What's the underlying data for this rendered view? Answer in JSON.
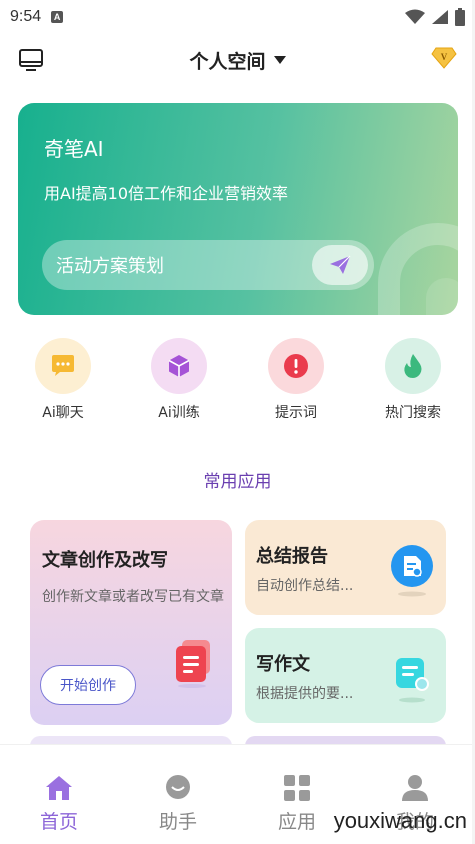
{
  "status_bar": {
    "time": "9:54",
    "notif_letter": "A"
  },
  "header": {
    "title": "个人空间"
  },
  "banner": {
    "title": "奇笔AI",
    "subtitle": "用AI提高10倍工作和企业营销效率",
    "input_text": "活动方案策划"
  },
  "quick_actions": [
    {
      "label": "Ai聊天",
      "icon": "chat-bubble-icon",
      "bg": "#fdefd2",
      "fg": "#f6b933"
    },
    {
      "label": "Ai训练",
      "icon": "cube-icon",
      "bg": "#f4dcf3",
      "fg": "#a553d6"
    },
    {
      "label": "提示词",
      "icon": "alert-icon",
      "bg": "#fbd9dc",
      "fg": "#ea3b4d"
    },
    {
      "label": "热门搜索",
      "icon": "flame-icon",
      "bg": "#d8f1e6",
      "fg": "#3cb97e"
    }
  ],
  "section_title": "常用应用",
  "cards": {
    "article": {
      "title": "文章创作及改写",
      "desc": "创作新文章或者改写已有文章",
      "button": "开始创作"
    },
    "summary": {
      "title": "总结报告",
      "desc": "自动创作总结..."
    },
    "essay": {
      "title": "写作文",
      "desc": "根据提供的要..."
    }
  },
  "tabbar": [
    {
      "label": "首页",
      "active": true
    },
    {
      "label": "助手",
      "active": false
    },
    {
      "label": "应用",
      "active": false
    },
    {
      "label": "我的",
      "active": false
    }
  ],
  "watermark": "youxiwang.cn",
  "colors": {
    "accent": "#8d66d8",
    "banner_start": "#17b08e",
    "banner_end": "#a9d59f"
  }
}
